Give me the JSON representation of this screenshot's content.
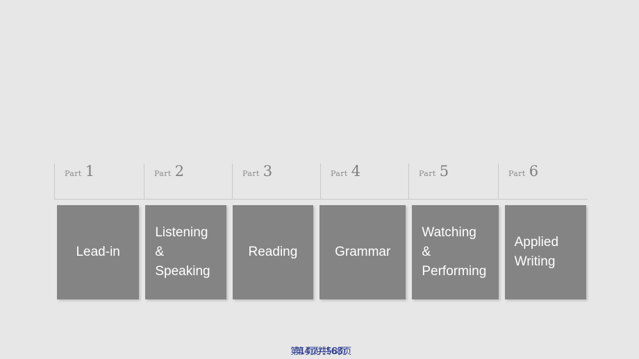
{
  "slide": {
    "background_color": "#e7e7e7",
    "tile_color": "#848484",
    "tile_text_color": "#ffffff",
    "part_label_color": "#8a8a8a",
    "divider_color": "#c9c9c9",
    "footer_color": "#2b3a8f"
  },
  "parts": [
    {
      "label": "Part",
      "number": "1",
      "title": "Lead-in",
      "align": "center",
      "width": 120
    },
    {
      "label": "Part",
      "number": "2",
      "title": "Listening\n&\nSpeaking",
      "align": "left",
      "width": 120
    },
    {
      "label": "Part",
      "number": "3",
      "title": "Reading",
      "align": "center",
      "width": 120
    },
    {
      "label": "Part",
      "number": "4",
      "title": "Grammar",
      "align": "center",
      "width": 120
    },
    {
      "label": "Part",
      "number": "5",
      "title": "Watching\n&\nPerforming",
      "align": "left",
      "width": 120
    },
    {
      "label": "Part",
      "number": "6",
      "title": "Applied\nWriting",
      "align": "left",
      "width": 120
    }
  ],
  "footer": {
    "page_indicator_primary": "第1页/共58页",
    "page_indicator_secondary": "第4页/共68页"
  }
}
